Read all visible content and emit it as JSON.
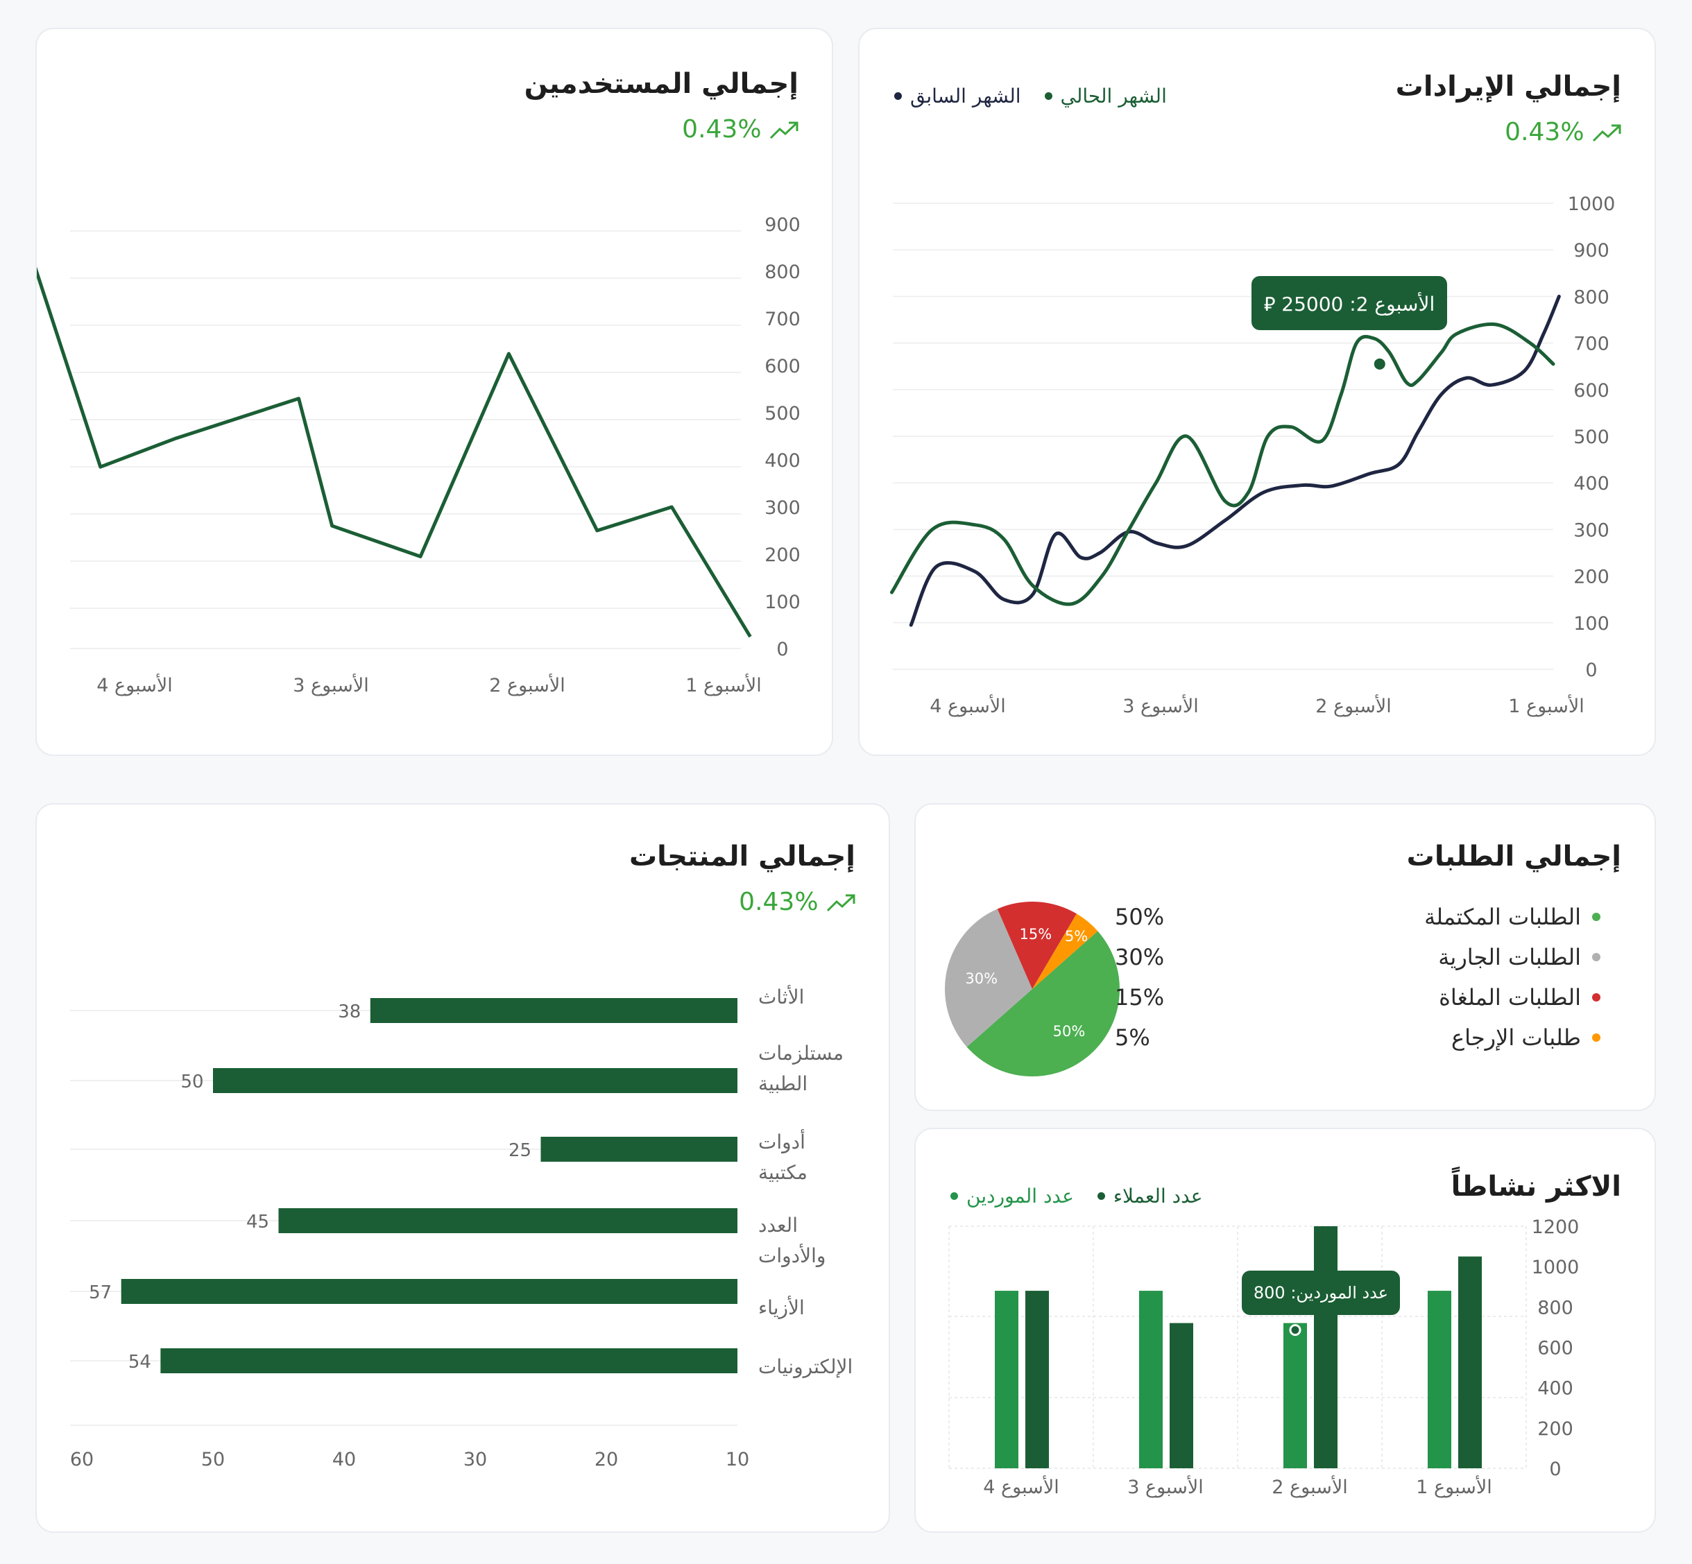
{
  "colors": {
    "dark_green": "#1b5e35",
    "navy": "#1f2642",
    "mid_green": "#24944a",
    "light_green": "#4caf50",
    "gray": "#b0b0b0",
    "red": "#d32f2f",
    "orange": "#ff9800",
    "trend_green": "#3aa63a"
  },
  "icons": {
    "trend": "trending-up-icon"
  },
  "revenue": {
    "title": "إجمالي الإيرادات",
    "trend": "0.43%",
    "legend": {
      "current": "الشهر الحالي",
      "previous": "الشهر السابق"
    },
    "tooltip": "الأسبوع 2:  25000 ⃁"
  },
  "users": {
    "title": "إجمالي المستخدمين",
    "trend": "0.43%"
  },
  "products": {
    "title": "إجمالي المنتجات",
    "trend": "0.43%"
  },
  "orders": {
    "title": "إجمالي الطلبات",
    "items": [
      {
        "label": "الطلبات المكتملة",
        "pct": "50%"
      },
      {
        "label": "الطلبات الجارية",
        "pct": "30%"
      },
      {
        "label": "الطلبات الملغاة",
        "pct": "15%"
      },
      {
        "label": "طلبات الإرجاع",
        "pct": "5%"
      }
    ]
  },
  "activity": {
    "title": "الاكثر نشاطاً",
    "legend": {
      "customers": "عدد العملاء",
      "suppliers": "عدد الموردين"
    },
    "tooltip": "عدد الموردين:  800"
  },
  "chart_data": [
    {
      "id": "revenue",
      "type": "line",
      "title": "إجمالي الإيرادات",
      "categories": [
        "الأسبوع 1",
        "الأسبوع 2",
        "الأسبوع 3",
        "الأسبوع 4"
      ],
      "ylim": [
        0,
        1000
      ],
      "yticks": [
        0,
        100,
        200,
        300,
        400,
        500,
        600,
        700,
        800,
        900,
        1000
      ],
      "x_reversed": true,
      "grid": true,
      "legend_position": "top-left",
      "series": [
        {
          "name": "الشهر الحالي",
          "color": "#1b5e35",
          "x": [
            0,
            0.12,
            0.3,
            0.5,
            0.58,
            0.7,
            0.76,
            0.85,
            0.93,
            1.02,
            1.1,
            1.2,
            1.36,
            1.48,
            1.58,
            1.7,
            1.9,
            2.06,
            2.2,
            2.34,
            2.5,
            2.7,
            2.85,
            3.0,
            3.22,
            3.43
          ],
          "values": [
            655,
            700,
            740,
            720,
            680,
            620,
            615,
            680,
            710,
            700,
            590,
            490,
            520,
            500,
            380,
            360,
            500,
            400,
            300,
            200,
            140,
            180,
            280,
            310,
            300,
            165
          ]
        },
        {
          "name": "الشهر السابق",
          "color": "#1f2642",
          "x": [
            -0.03,
            0.05,
            0.15,
            0.32,
            0.45,
            0.58,
            0.7,
            0.8,
            0.95,
            1.15,
            1.3,
            1.5,
            1.7,
            1.9,
            2.05,
            2.2,
            2.35,
            2.45,
            2.58,
            2.7,
            2.85,
            3.0,
            3.2,
            3.33
          ],
          "values": [
            800,
            720,
            640,
            610,
            625,
            590,
            510,
            440,
            420,
            393,
            395,
            380,
            320,
            265,
            270,
            295,
            250,
            240,
            290,
            160,
            150,
            210,
            220,
            95
          ]
        }
      ],
      "annotation": {
        "label": "الأسبوع 2:  25000",
        "x": 0.9,
        "y": 655
      }
    },
    {
      "id": "users",
      "type": "line",
      "title": "إجمالي المستخدمين",
      "categories": [
        "الأسبوع 1",
        "الأسبوع 2",
        "الأسبوع 3",
        "الأسبوع 4"
      ],
      "ylim": [
        0,
        900
      ],
      "yticks": [
        0,
        100,
        200,
        300,
        400,
        500,
        600,
        700,
        800,
        900
      ],
      "x_reversed": true,
      "grid": true,
      "series": [
        {
          "name": "",
          "color": "#1b5e35",
          "x": [
            -0.03,
            0.37,
            0.75,
            1.2,
            1.65,
            2.1,
            2.27,
            2.9,
            3.28,
            3.72,
            4.15
          ],
          "values": [
            25,
            300,
            250,
            625,
            195,
            260,
            530,
            445,
            385,
            945,
            945
          ],
          "note": "last point cut off at top edge"
        }
      ]
    },
    {
      "id": "products",
      "type": "bar",
      "orientation": "horizontal",
      "title": "إجمالي المنتجات",
      "categories": [
        "الأثاث",
        "مستلزمات الطبية",
        "أدوات مكتبية",
        "العدد والأدوات",
        "الأزياء",
        "الإلكترونيات"
      ],
      "values": [
        38,
        50,
        25,
        45,
        57,
        54
      ],
      "xticks": [
        10,
        20,
        30,
        40,
        50,
        60
      ],
      "xlim": [
        10,
        60
      ],
      "x_reversed": true,
      "color": "#1b5e35"
    },
    {
      "id": "orders",
      "type": "pie",
      "title": "إجمالي الطلبات",
      "labels": [
        "الطلبات المكتملة",
        "الطلبات الجارية",
        "الطلبات الملغاة",
        "طلبات الإرجاع"
      ],
      "values": [
        50,
        30,
        15,
        5
      ],
      "colors": [
        "#4caf50",
        "#b0b0b0",
        "#d32f2f",
        "#ff9800"
      ]
    },
    {
      "id": "activity",
      "type": "bar",
      "title": "الاكثر نشاطاً",
      "categories": [
        "الأسبوع 1",
        "الأسبوع 2",
        "الأسبوع 3",
        "الأسبوع 4"
      ],
      "ylim": [
        0,
        1200
      ],
      "yticks": [
        0,
        200,
        400,
        600,
        800,
        1000,
        1200
      ],
      "x_reversed": true,
      "grid": true,
      "legend_position": "top-left",
      "series": [
        {
          "name": "عدد العملاء",
          "color": "#1b5e35",
          "values": [
            1050,
            1200,
            720,
            880
          ]
        },
        {
          "name": "عدد الموردين",
          "color": "#24944a",
          "values": [
            880,
            720,
            880,
            880
          ]
        }
      ],
      "annotation": {
        "label": "عدد الموردين:  800",
        "category": "الأسبوع 2",
        "value": 720
      }
    }
  ]
}
